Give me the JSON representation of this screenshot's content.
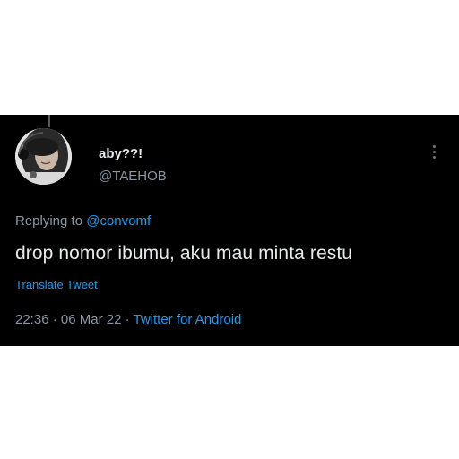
{
  "tweet": {
    "display_name": "aby??!",
    "handle": "@TAEHOB",
    "replying_prefix": "Replying to ",
    "replying_to": "@convomf",
    "text": "drop nomor ibumu, aku mau minta restu",
    "translate_label": "Translate Tweet",
    "time": "22:36",
    "separator": " · ",
    "date": "06 Mar 22",
    "source": "Twitter for Android"
  },
  "icons": {
    "more": "more-vertical-icon",
    "avatar": "avatar"
  },
  "colors": {
    "background": "#000000",
    "text": "#e7e9ea",
    "secondary": "#8b98a5",
    "link": "#1d9bf0"
  }
}
